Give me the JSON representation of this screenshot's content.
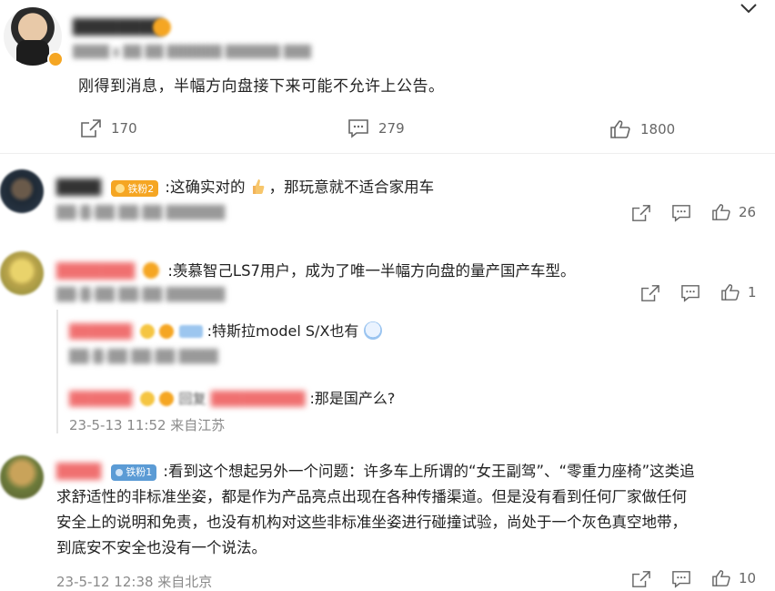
{
  "post": {
    "author": "",
    "meta": "",
    "text": "刚得到消息，半幅方向盘接下来可能不允许上公告。",
    "forward_count": "170",
    "comment_count": "279",
    "like_count": "1800"
  },
  "comments": [
    {
      "text": ":这确实对的",
      "text_tail": "，那玩意就不适合家用车",
      "badge": "铁粉2",
      "like_count": "26"
    },
    {
      "text": ":羡慕智己LS7用户，成为了唯一半幅方向盘的量产国产车型。",
      "like_count": "1",
      "replies": [
        {
          "text": ":特斯拉model S/X也有"
        },
        {
          "text": ":那是国产么?",
          "reply_prefix": "回复",
          "meta": "23-5-13 11:52 来自江苏"
        }
      ]
    },
    {
      "badge": "铁粉1",
      "lines": [
        ":看到这个想起另外一个问题：许多车上所谓的“女王副驾”、“零重力座椅”这类追",
        "求舒适性的非标准坐姿，都是作为产品亮点出现在各种传播渠道。但是没有看到任何厂家做任何",
        "安全上的说明和免责，也没有机构对这些非标准坐姿进行碰撞试验，尚处于一个灰色真空地带，",
        "到底安不安全也没有一个说法。"
      ],
      "meta": "23-5-12 12:38 来自北京",
      "like_count": "10"
    }
  ],
  "colors": {
    "accent": "#ff8200",
    "badge_orange": "#f5a623",
    "badge_blue": "#5b9bd5"
  }
}
